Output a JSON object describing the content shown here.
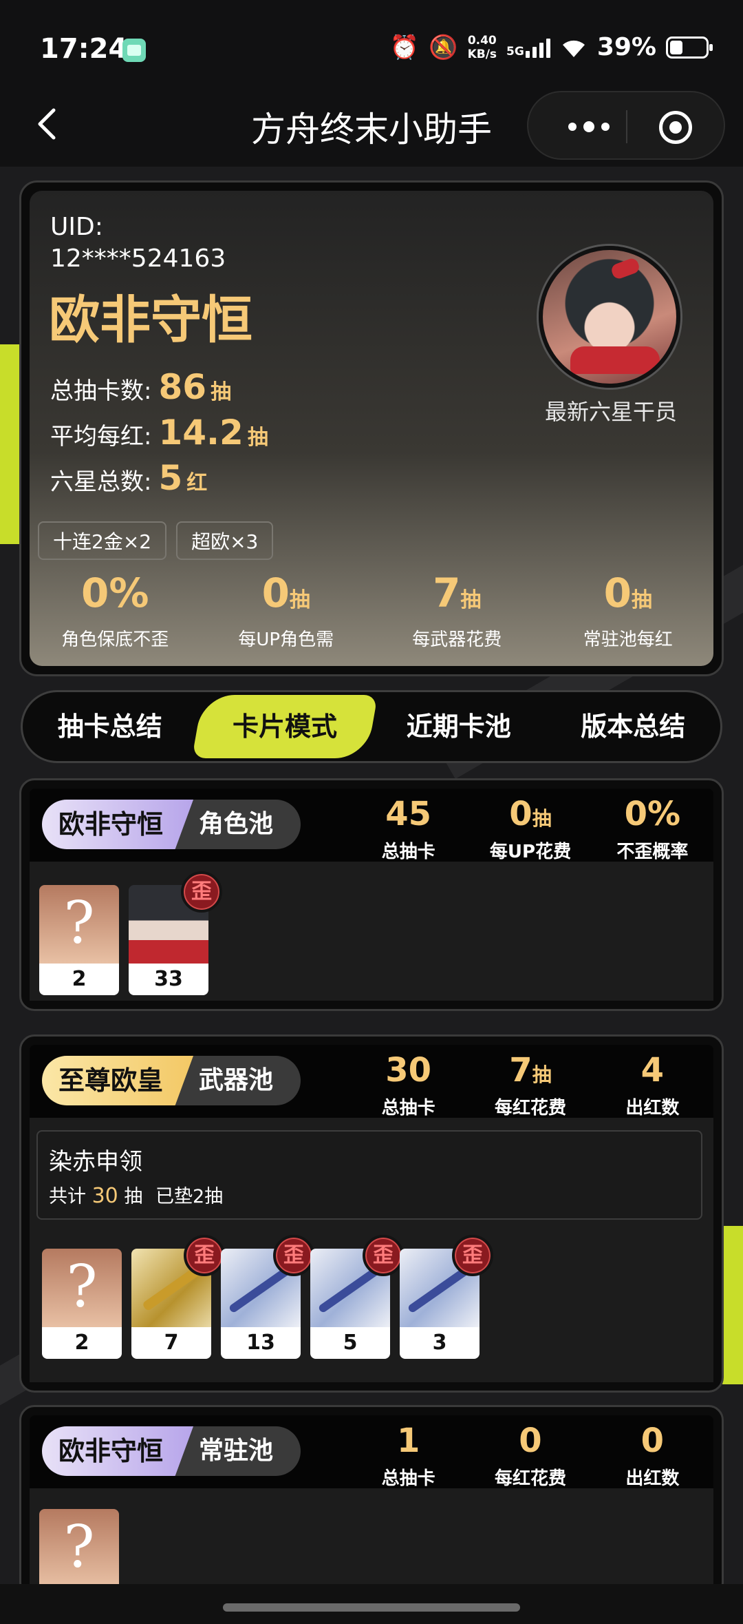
{
  "status_bar": {
    "time": "17:24",
    "speed_top": "0.40",
    "speed_unit": "KB/s",
    "network": "5G",
    "battery": "39%"
  },
  "nav": {
    "title": "方舟终末小助手"
  },
  "profile": {
    "uid_label": "UID:",
    "uid_value": "12****524163",
    "rank_title": "欧非守恒",
    "total_pulls_label": "总抽卡数:",
    "total_pulls_value": "86",
    "total_pulls_unit": "抽",
    "avg_per_six_label": "平均每红:",
    "avg_per_six_value": "14.2",
    "avg_per_six_unit": "抽",
    "six_star_total_label": "六星总数:",
    "six_star_total_value": "5",
    "six_star_total_unit": "红",
    "avatar_label": "最新六星干员",
    "tags": [
      "十连2金×2",
      "超欧×3"
    ],
    "mini_stats": [
      {
        "value": "0%",
        "unit": "",
        "label": "角色保底不歪"
      },
      {
        "value": "0",
        "unit": "抽",
        "label": "每UP角色需"
      },
      {
        "value": "7",
        "unit": "抽",
        "label": "每武器花费"
      },
      {
        "value": "0",
        "unit": "抽",
        "label": "常驻池每红"
      }
    ]
  },
  "tabs": [
    {
      "label": "抽卡总结",
      "active": false
    },
    {
      "label": "卡片模式",
      "active": true
    },
    {
      "label": "近期卡池",
      "active": false
    },
    {
      "label": "版本总结",
      "active": false
    }
  ],
  "pools": {
    "character": {
      "badge": "欧非守恒",
      "name": "角色池",
      "stats": [
        {
          "value": "45",
          "unit": "",
          "label": "总抽卡"
        },
        {
          "value": "0",
          "unit": "抽",
          "label": "每UP花费"
        },
        {
          "value": "0%",
          "unit": "",
          "label": "不歪概率"
        }
      ],
      "cards": [
        {
          "art": "unknown",
          "count": "2",
          "waai": ""
        },
        {
          "art": "girl",
          "count": "33",
          "waai": "歪"
        }
      ]
    },
    "weapon": {
      "badge": "至尊欧皇",
      "name": "武器池",
      "stats": [
        {
          "value": "30",
          "unit": "",
          "label": "总抽卡"
        },
        {
          "value": "7",
          "unit": "抽",
          "label": "每红花费"
        },
        {
          "value": "4",
          "unit": "",
          "label": "出红数"
        }
      ],
      "banner_name": "染赤申领",
      "banner_info_prefix": "共计",
      "banner_info_count": "30",
      "banner_info_suffix": "抽",
      "banner_info_pity": "已垫2抽",
      "cards": [
        {
          "art": "unknown",
          "count": "2",
          "waai": ""
        },
        {
          "art": "gold",
          "count": "7",
          "waai": "歪"
        },
        {
          "art": "blue",
          "count": "13",
          "waai": "歪"
        },
        {
          "art": "blue",
          "count": "5",
          "waai": "歪"
        },
        {
          "art": "blue",
          "count": "3",
          "waai": "歪"
        }
      ]
    },
    "standard": {
      "badge": "欧非守恒",
      "name": "常驻池",
      "stats": [
        {
          "value": "1",
          "unit": "",
          "label": "总抽卡"
        },
        {
          "value": "0",
          "unit": "",
          "label": "每红花费"
        },
        {
          "value": "0",
          "unit": "",
          "label": "出红数"
        }
      ]
    }
  }
}
